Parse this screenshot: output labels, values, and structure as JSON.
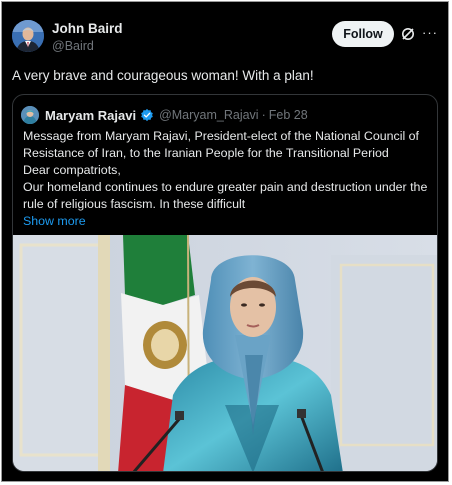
{
  "author": {
    "name": "John Baird",
    "handle": "@Baird",
    "avatar_icon": "profile-photo"
  },
  "actions": {
    "follow_label": "Follow",
    "grok_icon": "grok-slash-icon",
    "more_icon": "more-horizontal-icon"
  },
  "tweet": {
    "text": "A very brave and courageous woman! With a plan!"
  },
  "quoted": {
    "name": "Maryam Rajavi",
    "handle": "@Maryam_Rajavi",
    "separator": "·",
    "date": "Feb 28",
    "verified_icon": "verified-badge-icon",
    "lines": [
      "Message from Maryam Rajavi, President-elect of the National Council of",
      "Resistance of Iran, to the Iranian People for the Transitional Period",
      "Dear compatriots,",
      "Our homeland continues to endure greater pain and destruction under the",
      "rule of religious fascism. In these difficult"
    ],
    "show_more": "Show more",
    "image_icon": "photo-woman-in-blue-headscarf-before-flag"
  },
  "colors": {
    "background": "#000000",
    "text": "#e7e9ea",
    "secondary": "#71767b",
    "link": "#1d9bf0",
    "follow_bg": "#eff3f4",
    "border": "#333639"
  }
}
